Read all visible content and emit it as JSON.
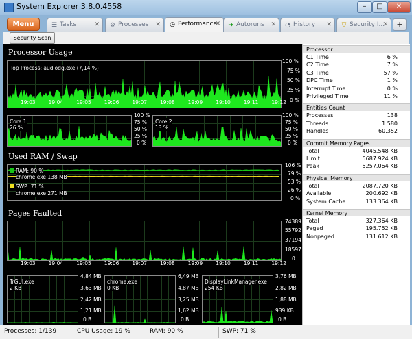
{
  "window": {
    "title": "System Explorer 3.8.0.4558",
    "min_glyph": "–",
    "max_glyph": "□",
    "close_glyph": "✕"
  },
  "menu_label": "Menu",
  "tabs": [
    {
      "label": "Tasks",
      "icon": "list-icon",
      "glyph": "☰"
    },
    {
      "label": "Processes",
      "icon": "gear-icon",
      "glyph": "⚙"
    },
    {
      "label": "Performance",
      "icon": "clock-icon",
      "glyph": "◷",
      "active": true
    },
    {
      "label": "Autoruns",
      "icon": "arrow-icon",
      "glyph": "➜"
    },
    {
      "label": "History",
      "icon": "history-icon",
      "glyph": "◔"
    },
    {
      "label": "Security I...",
      "icon": "shield-icon",
      "glyph": "⛉"
    }
  ],
  "tab_close_glyph": "✕",
  "tab_add_glyph": "+",
  "toolbar": {
    "scan_label": "Security Scan"
  },
  "performance": {
    "cpu": {
      "title": "Processor Usage",
      "top_process": "Top Process: audiodg.exe (7,14 %)",
      "axis": [
        "100 %",
        "75 %",
        "50 %",
        "25 %",
        "0 %"
      ],
      "times": [
        "19:03",
        "19:04",
        "19:05",
        "19:06",
        "19:07",
        "19:08",
        "19:09",
        "19:10",
        "19:11",
        "19:12"
      ],
      "core1_label": "Core 1",
      "core1_value": "26 %",
      "core2_label": "Core 2",
      "core2_value": "13 %",
      "core_axis": [
        "100 %",
        "75 %",
        "50 %",
        "25 %",
        "0 %"
      ]
    },
    "ram": {
      "title": "Used RAM / Swap",
      "ram_label": "RAM: 90 %",
      "ram_process": "chrome.exe 138 MB",
      "swp_label": "SWP: 71 %",
      "swp_process": "chrome.exe 271 MB",
      "axis": [
        "106 %",
        "79 %",
        "53 %",
        "26 %",
        "0 %"
      ],
      "ram_color": "#18c418",
      "swp_color": "#f0e020"
    },
    "pages": {
      "title": "Pages Faulted",
      "axis": [
        "74389",
        "55792",
        "37194",
        "18597",
        "0"
      ],
      "times": [
        "19:03",
        "19:04",
        "19:05",
        "19:06",
        "19:07",
        "19:08",
        "19:09",
        "19:10",
        "19:11",
        "19:12"
      ]
    },
    "mini": [
      {
        "name": "TrGUI.exe",
        "value": "2 KB",
        "axis": [
          "4,84 MB",
          "3,63 MB",
          "2,42 MB",
          "1,21 MB",
          "0 B"
        ]
      },
      {
        "name": "chrome.exe",
        "value": "0 KB",
        "axis": [
          "6,49 MB",
          "4,87 MB",
          "3,25 MB",
          "1,62 MB",
          "0 B"
        ]
      },
      {
        "name": "DisplayLinkManager.exe",
        "value": "254 KB",
        "axis": [
          "3,76 MB",
          "2,82 MB",
          "1,88 MB",
          "939 KB",
          "0 B"
        ]
      }
    ],
    "graph_color": "#1ee81e"
  },
  "sidebar": {
    "groups": [
      {
        "title": "Processor",
        "rows": [
          [
            "C1 Time",
            "6 %"
          ],
          [
            "C2 Time",
            "7 %"
          ],
          [
            "C3 Time",
            "57 %"
          ],
          [
            "DPC Time",
            "1 %"
          ],
          [
            "Interrupt Time",
            "0 %"
          ],
          [
            "Privileged Time",
            "11 %"
          ]
        ]
      },
      {
        "title": "Entities Count",
        "rows": [
          [
            "Processes",
            "138"
          ],
          [
            "Threads",
            "1.580"
          ],
          [
            "Handles",
            "60.352"
          ]
        ]
      },
      {
        "title": "Commit Memory Pages",
        "rows": [
          [
            "Total",
            "4045.548 KB"
          ],
          [
            "Limit",
            "5687.924 KB"
          ],
          [
            "Peak",
            "5257.064 KB"
          ]
        ]
      },
      {
        "title": "Physical Memory",
        "rows": [
          [
            "Total",
            "2087.720 KB"
          ],
          [
            "Available",
            "200.692 KB"
          ],
          [
            "System Cache",
            "133.364 KB"
          ]
        ]
      },
      {
        "title": "Kernel Memory",
        "rows": [
          [
            "Total",
            "327.364 KB"
          ],
          [
            "Paged",
            "195.752 KB"
          ],
          [
            "Nonpaged",
            "131.612 KB"
          ]
        ]
      }
    ]
  },
  "status": {
    "processes": "Processes: 1/139",
    "cpu": "CPU Usage: 19 %",
    "ram": "RAM: 90 %",
    "swp": "SWP: 71 %"
  }
}
